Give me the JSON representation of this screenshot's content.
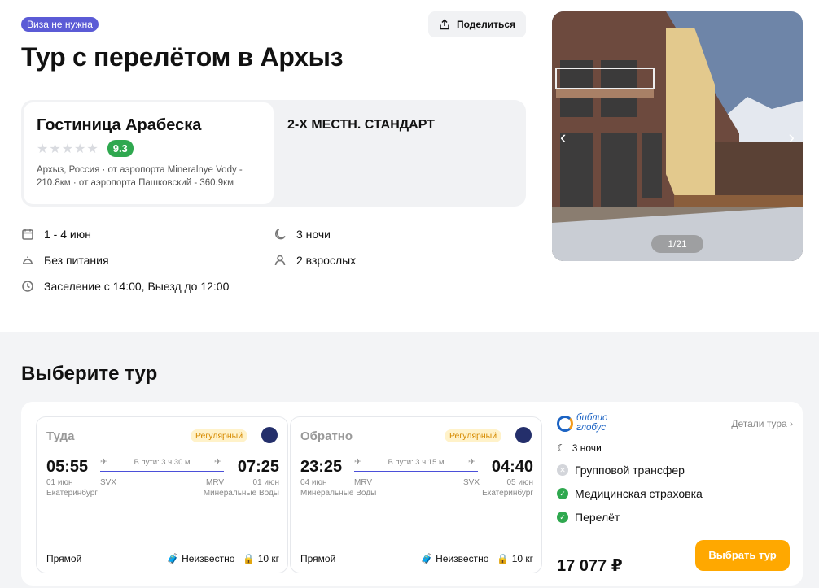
{
  "header": {
    "visa_badge": "Виза не нужна",
    "share_label": "Поделиться",
    "title": "Тур с перелётом в Архыз"
  },
  "hotel": {
    "name": "Гостиница Арабеска",
    "stars": "★★★★★",
    "rating": "9.3",
    "location_line1": "Архыз, Россия · от аэропорта Mineralnye Vody -",
    "location_line2": "210.8км · от аэропорта Пашковский - 360.9км",
    "room_type": "2-Х МЕСТН. СТАНДАРТ"
  },
  "info": {
    "dates": "1 - 4 июн",
    "nights": "3 ночи",
    "meal": "Без питания",
    "guests": "2 взрослых",
    "checkin": "Заселение с 14:00, Выезд до 12:00"
  },
  "gallery": {
    "counter": "1/21",
    "prev": "‹",
    "next": "›"
  },
  "section": {
    "title": "Выберите тур"
  },
  "outbound": {
    "direction": "Туда",
    "badge": "Регулярный",
    "dep_time": "05:55",
    "arr_time": "07:25",
    "duration": "В пути: 3 ч 30 м",
    "dep_date": "01 июн",
    "dep_city": "Екатеринбург",
    "dep_code": "SVX",
    "arr_code": "MRV",
    "arr_date": "01 июн",
    "arr_city": "Минеральные Воды",
    "type": "Прямой",
    "baggage": "Неизвестно",
    "hand_luggage": "10 кг"
  },
  "inbound": {
    "direction": "Обратно",
    "badge": "Регулярный",
    "dep_time": "23:25",
    "arr_time": "04:40",
    "duration": "В пути: 3 ч 15 м",
    "dep_date": "04 июн",
    "dep_city": "Минеральные Воды",
    "dep_code": "MRV",
    "arr_code": "SVX",
    "arr_date": "05 июн",
    "arr_city": "Екатеринбург",
    "type": "Прямой",
    "baggage": "Неизвестно",
    "hand_luggage": "10 кг"
  },
  "tour": {
    "operator_line1": "библио",
    "operator_line2": "глобус",
    "details": "Детали тура ›",
    "nights": "3 ночи",
    "transfer": "Групповой трансфер",
    "insurance": "Медицинская страховка",
    "flight": "Перелёт",
    "price": "17 077 ₽",
    "select_label": "Выбрать тур"
  },
  "colors": {
    "accent": "#5b5bd6",
    "rating_green": "#2fa84f",
    "cta_orange": "#ffa800",
    "badge_yellow": "#fff2c9"
  }
}
